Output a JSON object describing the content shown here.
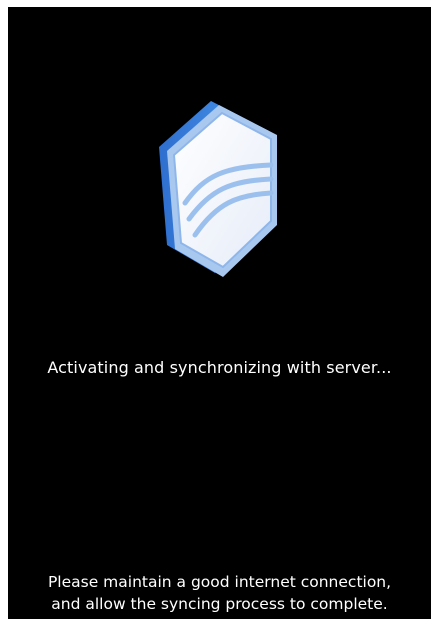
{
  "app": {
    "logo_icon": "hexagon-shield-logo-icon",
    "accent_color": "#3f8de0",
    "background_color": "#000000",
    "text_color": "#ffffff"
  },
  "status": {
    "message": "Activating and synchronizing with server..."
  },
  "notice": {
    "line1": "Please maintain a good internet connection,",
    "line2": "and allow the syncing process to complete."
  }
}
